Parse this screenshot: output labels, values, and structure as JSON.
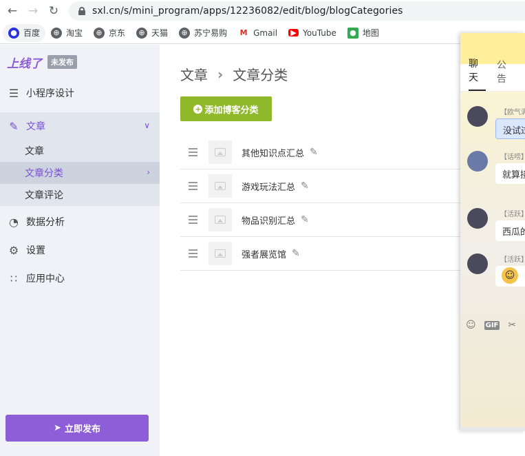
{
  "browser": {
    "url": "sxl.cn/s/mini_program/apps/12236082/edit/blog/blogCategories",
    "bookmarks": [
      {
        "label": "百度",
        "icon": "baidu-icon"
      },
      {
        "label": "淘宝",
        "icon": "globe-icon"
      },
      {
        "label": "京东",
        "icon": "globe-icon"
      },
      {
        "label": "天猫",
        "icon": "globe-icon"
      },
      {
        "label": "苏宁易购",
        "icon": "globe-icon"
      },
      {
        "label": "Gmail",
        "icon": "gmail-icon"
      },
      {
        "label": "YouTube",
        "icon": "youtube-icon"
      },
      {
        "label": "地图",
        "icon": "maps-icon"
      }
    ]
  },
  "sidebar": {
    "brand": "上线了",
    "badge": "未发布",
    "items": [
      {
        "label": "小程序设计",
        "icon": "layers-icon"
      },
      {
        "label": "文章",
        "icon": "feather-icon"
      },
      {
        "label": "数据分析",
        "icon": "pie-chart-icon"
      },
      {
        "label": "设置",
        "icon": "gear-icon"
      },
      {
        "label": "应用中心",
        "icon": "apps-icon"
      }
    ],
    "sub_items": [
      {
        "label": "文章"
      },
      {
        "label": "文章分类"
      },
      {
        "label": "文章评论"
      }
    ],
    "publish_label": "立即发布"
  },
  "main": {
    "breadcrumb": [
      "文章",
      "文章分类"
    ],
    "add_button": "添加博客分类",
    "categories": [
      {
        "name": "其他知识点汇总"
      },
      {
        "name": "游戏玩法汇总"
      },
      {
        "name": "物品识别汇总"
      },
      {
        "name": "强者展览馆"
      }
    ]
  },
  "chat": {
    "tabs": [
      "聊天",
      "公告"
    ],
    "messages": [
      {
        "tag": "【欧气满",
        "text": "没试过"
      },
      {
        "tag": "【话唠】",
        "text": "就算接"
      },
      {
        "tag": "【活跃】",
        "text": "西瓜的"
      },
      {
        "tag": "【活跃】",
        "text": ""
      }
    ]
  },
  "colors": {
    "accent": "#8e5dd8",
    "add_button": "#8fb82a",
    "sidebar_bg": "#f0f2f7"
  }
}
